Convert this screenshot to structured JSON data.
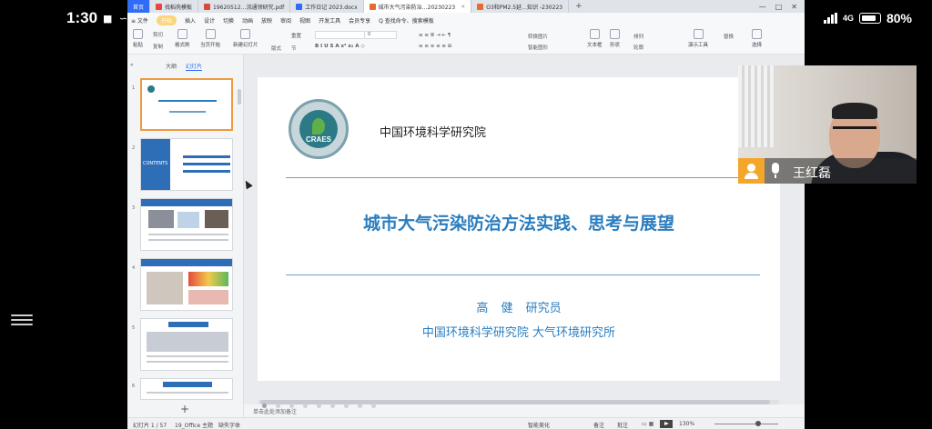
{
  "status_bar": {
    "time": "1:30",
    "left_icons": "■ ∽ ♥ ▷",
    "network": "4G",
    "battery": "80%"
  },
  "tabs": [
    {
      "label": "首页",
      "kind": "home"
    },
    {
      "label": "找稻壳模板",
      "kind": "normal"
    },
    {
      "label": "19620512…流通领研究.pdf",
      "kind": "normal"
    },
    {
      "label": "工作日记 2023.docx",
      "kind": "normal"
    },
    {
      "label": "城市大气污染防治…20230223",
      "kind": "active"
    },
    {
      "label": "O3和PM2.5延…知识 -230223",
      "kind": "normal"
    }
  ],
  "tab_plus": "+",
  "menus": [
    {
      "label": "≡ 文件",
      "style": ""
    },
    {
      "label": "开始",
      "style": "sel"
    },
    {
      "label": "插入",
      "style": ""
    },
    {
      "label": "设计",
      "style": ""
    },
    {
      "label": "切换",
      "style": ""
    },
    {
      "label": "动画",
      "style": ""
    },
    {
      "label": "放映",
      "style": ""
    },
    {
      "label": "审阅",
      "style": ""
    },
    {
      "label": "视图",
      "style": ""
    },
    {
      "label": "开发工具",
      "style": ""
    },
    {
      "label": "会员专享",
      "style": ""
    },
    {
      "label": "Q 查找命令、搜索模板",
      "style": ""
    }
  ],
  "ribbon": {
    "paste": "粘贴",
    "cut": "剪切",
    "copy": "复制",
    "format_painter": "格式刷",
    "from_current": "当页开始",
    "new_slide": "新建幻灯片",
    "layout": "版式",
    "section": "节",
    "reset": "重置",
    "font_size": "0",
    "text_box": "文本框",
    "shape": "形状",
    "arrange": "排列",
    "outline": "轮廓",
    "presentation_tools": "演示工具",
    "replace": "替换",
    "select": "选择",
    "convert_image": "转换图片",
    "smart_graphic": "智能图形"
  },
  "left_panel": {
    "tab_outline": "大纲",
    "tab_slides": "幻灯片",
    "slide_numbers": [
      "1",
      "2",
      "3",
      "4",
      "5",
      "6"
    ],
    "contents_text": "CONTENTS",
    "add": "+"
  },
  "slide": {
    "institute": "中国环境科学研究院",
    "logo_text": "CRAES",
    "title": "城市大气污染防治方法实践、思考与展望",
    "author": "高 健 研究员",
    "affiliation": "中国环境科学研究院  大气环境研究所"
  },
  "notes_placeholder": "单击此处添加备注",
  "statusbar": {
    "slide_count": "幻灯片 1 / 57",
    "theme": "19_Office 主题",
    "font_missing": "缺失字体",
    "smart_beautify": "智能美化",
    "notes": "备注",
    "comments": "批注",
    "zoom": "130%"
  },
  "video": {
    "participant": "王红磊"
  },
  "colors": {
    "accent": "#2f6df6",
    "title_blue": "#2a7dbf",
    "orange": "#f4a62a"
  }
}
